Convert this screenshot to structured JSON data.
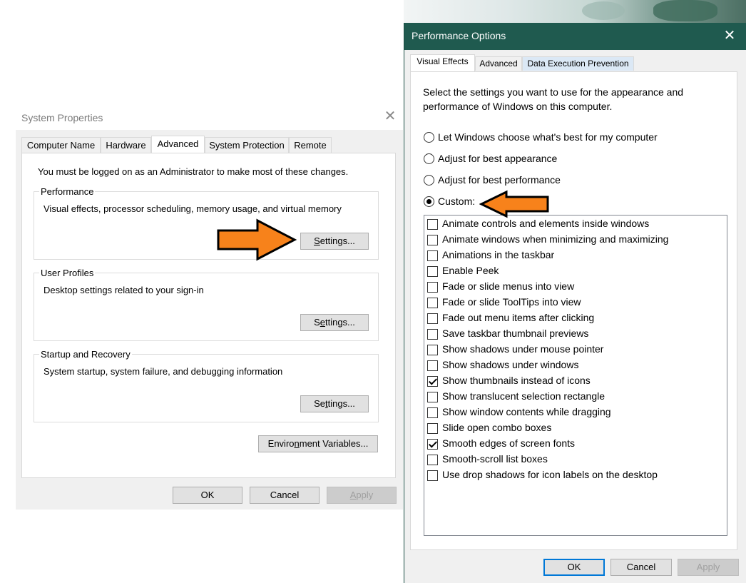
{
  "system_properties": {
    "title": "System Properties",
    "close_glyph": "✕",
    "tabs": [
      {
        "label": "Computer Name"
      },
      {
        "label": "Hardware"
      },
      {
        "label": "Advanced"
      },
      {
        "label": "System Protection"
      },
      {
        "label": "Remote"
      }
    ],
    "active_tab": "Advanced",
    "admin_note": "You must be logged on as an Administrator to make most of these changes.",
    "groups": [
      {
        "legend": "Performance",
        "description": "Visual effects, processor scheduling, memory usage, and virtual memory",
        "button": {
          "prefix": "",
          "key": "S",
          "rest": "ettings..."
        }
      },
      {
        "legend": "User Profiles",
        "description": "Desktop settings related to your sign-in",
        "button": {
          "prefix": "S",
          "key": "e",
          "rest": "ttings..."
        }
      },
      {
        "legend": "Startup and Recovery",
        "description": "System startup, system failure, and debugging information",
        "button": {
          "prefix": "Se",
          "key": "t",
          "rest": "tings..."
        }
      }
    ],
    "env_button": {
      "prefix": "Enviro",
      "key": "n",
      "rest": "ment Variables..."
    },
    "footer": {
      "ok": "OK",
      "cancel": "Cancel",
      "apply_key": "A",
      "apply_rest": "pply"
    }
  },
  "performance_options": {
    "title": "Performance Options",
    "close_glyph": "✕",
    "tabs": [
      {
        "label": "Visual Effects"
      },
      {
        "label": "Advanced"
      },
      {
        "label": "Data Execution Prevention"
      }
    ],
    "active_tab": "Visual Effects",
    "intro": "Select the settings you want to use for the appearance and performance of Windows on this computer.",
    "radios": [
      {
        "label": "Let Windows choose what's best for my computer",
        "checked": false
      },
      {
        "label": "Adjust for best appearance",
        "checked": false
      },
      {
        "label": "Adjust for best performance",
        "checked": false
      },
      {
        "label": "Custom:",
        "checked": true
      }
    ],
    "effects": [
      {
        "label": "Animate controls and elements inside windows",
        "checked": false
      },
      {
        "label": "Animate windows when minimizing and maximizing",
        "checked": false
      },
      {
        "label": "Animations in the taskbar",
        "checked": false
      },
      {
        "label": "Enable Peek",
        "checked": false
      },
      {
        "label": "Fade or slide menus into view",
        "checked": false
      },
      {
        "label": "Fade or slide ToolTips into view",
        "checked": false
      },
      {
        "label": "Fade out menu items after clicking",
        "checked": false
      },
      {
        "label": "Save taskbar thumbnail previews",
        "checked": false
      },
      {
        "label": "Show shadows under mouse pointer",
        "checked": false
      },
      {
        "label": "Show shadows under windows",
        "checked": false
      },
      {
        "label": "Show thumbnails instead of icons",
        "checked": true
      },
      {
        "label": "Show translucent selection rectangle",
        "checked": false
      },
      {
        "label": "Show window contents while dragging",
        "checked": false
      },
      {
        "label": "Slide open combo boxes",
        "checked": false
      },
      {
        "label": "Smooth edges of screen fonts",
        "checked": true
      },
      {
        "label": "Smooth-scroll list boxes",
        "checked": false
      },
      {
        "label": "Use drop shadows for icon labels on the desktop",
        "checked": false
      }
    ],
    "footer": {
      "ok": "OK",
      "cancel": "Cancel",
      "apply": "Apply"
    }
  },
  "annotations": {
    "arrow_color": "#f7821b",
    "arrow_outline": "#000000"
  },
  "colors": {
    "title_bar_active": "#1f5a4f",
    "accent": "#0078d7"
  }
}
